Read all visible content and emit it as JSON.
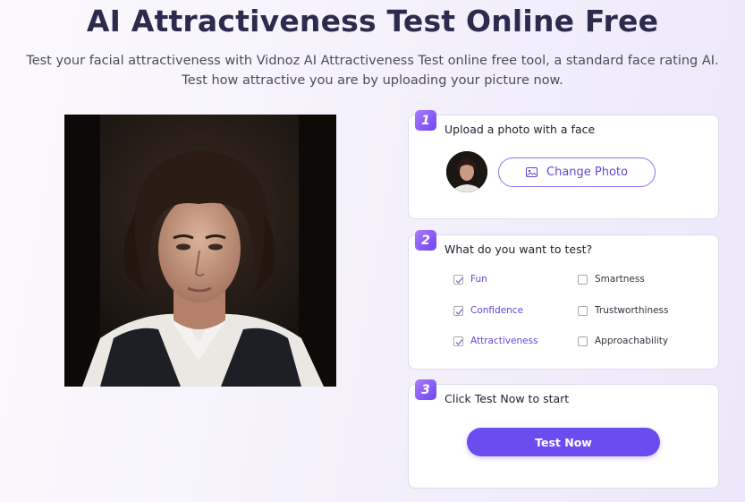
{
  "header": {
    "title": "AI Attractiveness Test Online Free",
    "subtitle_line1": "Test your facial attractiveness with Vidnoz AI Attractiveness Test online free tool, a standard face rating AI.",
    "subtitle_line2": "Test how attractive you are by uploading your picture now."
  },
  "step1": {
    "number": "1",
    "title": "Upload a photo with a face",
    "change_photo_label": "Change Photo",
    "change_photo_icon": "image-icon"
  },
  "step2": {
    "number": "2",
    "title": "What do you want to test?",
    "options": [
      {
        "label": "Fun",
        "checked": true
      },
      {
        "label": "Smartness",
        "checked": false
      },
      {
        "label": "Confidence",
        "checked": true
      },
      {
        "label": "Trustworthiness",
        "checked": false
      },
      {
        "label": "Attractiveness",
        "checked": true
      },
      {
        "label": "Approachability",
        "checked": false
      }
    ]
  },
  "step3": {
    "number": "3",
    "title": "Click Test Now to start",
    "test_now_label": "Test Now"
  },
  "colors": {
    "accent": "#6b4cf0",
    "title": "#2c2a4d",
    "checked_text": "#5a4bd9"
  }
}
